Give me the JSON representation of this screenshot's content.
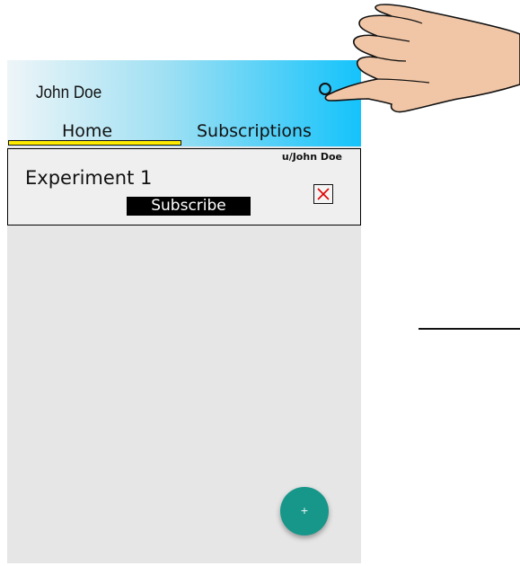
{
  "header": {
    "user_name": "John Doe",
    "search_icon": "search-icon",
    "tabs": [
      {
        "label": "Home",
        "active": true
      },
      {
        "label": "Subscriptions",
        "active": false
      }
    ]
  },
  "post": {
    "author": "u/John Doe",
    "title": "Experiment 1",
    "subscribe_label": "Subscribe",
    "close_icon": "close-icon"
  },
  "fab": {
    "label": "+"
  },
  "colors": {
    "header_gradient": [
      "#eef5f8",
      "#9fe0f3",
      "#14c3fb"
    ],
    "tab_indicator": "#ffeb00",
    "fab": "#17968a",
    "close_x": "#e00000",
    "background": "#e6e6e6"
  }
}
